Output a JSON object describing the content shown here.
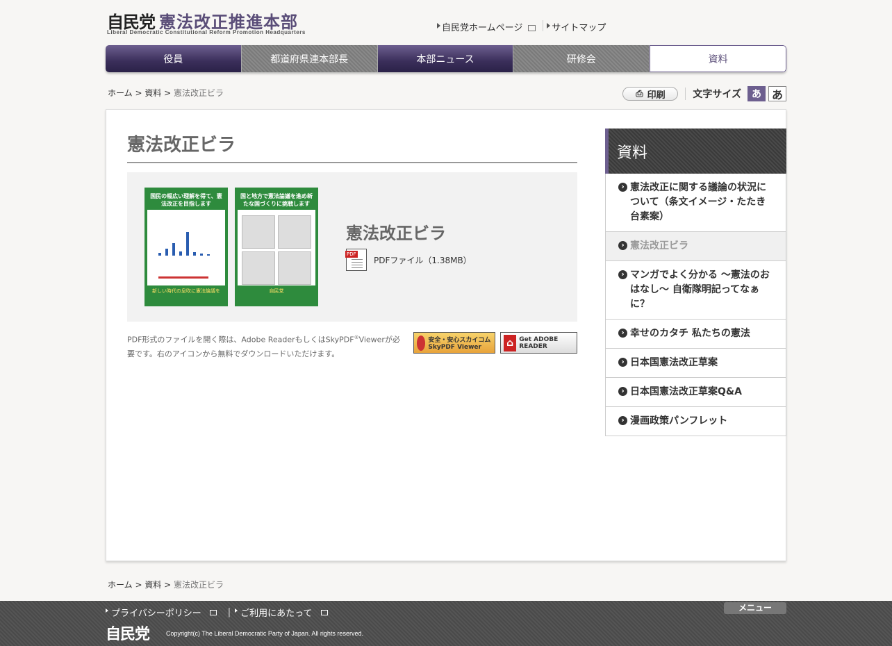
{
  "header": {
    "logo_ldp": "自民党",
    "logo_hq": "憲法改正推進本部",
    "logo_sub": "Liberal Democratic Constitutional Reform Promotion Headquarters",
    "links": [
      "自民党ホームページ",
      "サイトマップ"
    ]
  },
  "nav": {
    "items": [
      "役員",
      "都道府県連本部長",
      "本部ニュース",
      "研修会",
      "資料"
    ]
  },
  "breadcrumb": {
    "home": "ホーム",
    "sep": " > ",
    "section": "資料",
    "current": "憲法改正ビラ"
  },
  "tools": {
    "print": "印刷",
    "fontsize_label": "文字サイズ",
    "small": "あ",
    "large": "あ"
  },
  "main": {
    "title": "憲法改正ビラ",
    "item_title": "憲法改正ビラ",
    "pdf_label": "PDFファイル（1.38MB）",
    "pdf_tag": "PDF",
    "note_before_sup": "PDF形式のファイルを開く際は、Adobe ReaderもしくはSkyPDF",
    "note_sup": "®",
    "note_after_sup": "Viewerが必要です。右のアイコンから無料でダウンロードいただけます。",
    "flyer1": {
      "head": "国民の幅広い理解を得て、憲法改正を目指します",
      "foot": "新しい時代の息吹に憲法論議を"
    },
    "flyer2": {
      "head": "国と地方で憲法論議を進め新たな国づくりに挑戦します",
      "foot": "自民党"
    },
    "badge_sky": "安全・安心スカイコム SkyPDF Viewer",
    "badge_adobe": "Get ADOBE READER"
  },
  "sidebar": {
    "title": "資料",
    "items": [
      "憲法改正に関する議論の状況について（条文イメージ・たたき台素案）",
      "憲法改正ビラ",
      "マンガでよく分かる ～憲法のおはなし～ 自衛隊明記ってなぁに？",
      "幸せのカタチ 私たちの憲法",
      "日本国憲法改正草案",
      "日本国憲法改正草案Q&A",
      "漫画政策パンフレット"
    ]
  },
  "footer": {
    "links": [
      "プライバシーポリシー",
      "ご利用にあたって"
    ],
    "sep": "|",
    "logo": "自民党",
    "copyright": "Copyright(c) The Liberal Democratic Party of Japan. All rights reserved.",
    "menu": "メニュー"
  }
}
